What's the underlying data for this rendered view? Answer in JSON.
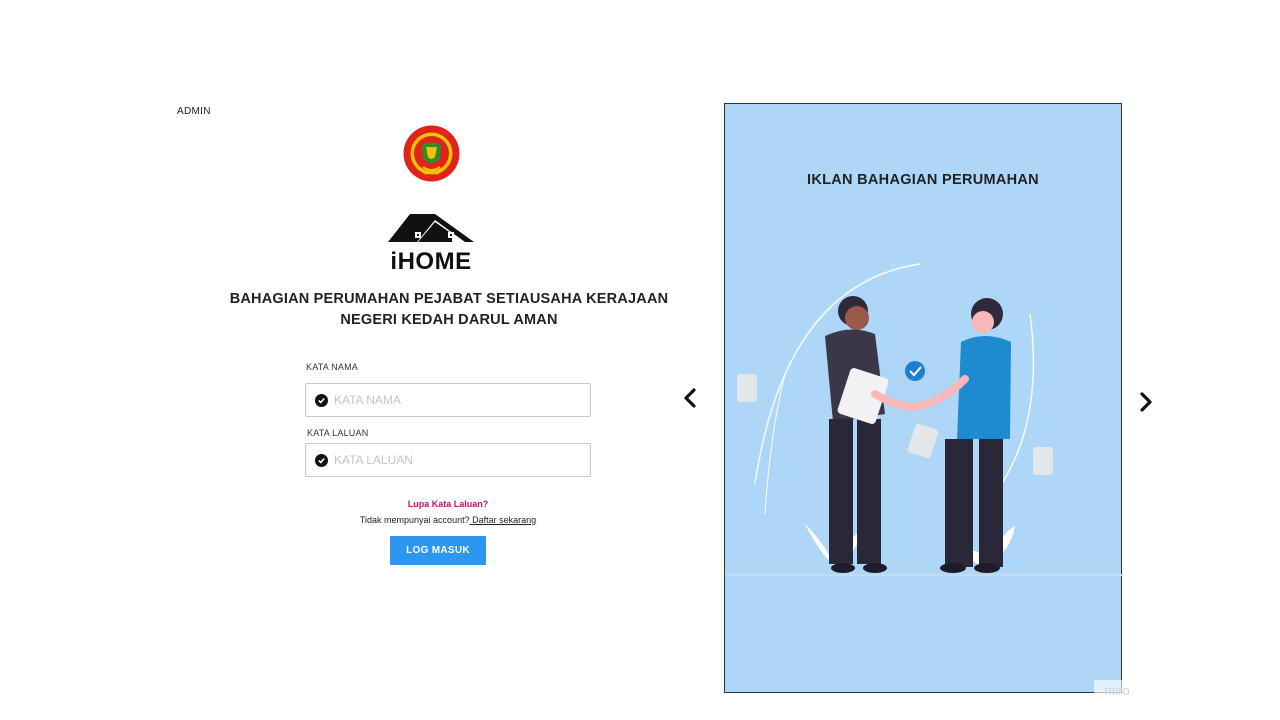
{
  "header": {
    "role_label": "ADMIN"
  },
  "logo": {
    "text": "iHOME"
  },
  "organization": {
    "line1": "BAHAGIAN PERUMAHAN PEJABAT SETIAUSAHA KERAJAAN",
    "line2": "NEGERI KEDAH DARUL AMAN"
  },
  "form": {
    "username_label": "KATA NAMA",
    "username_placeholder": "KATA NAMA",
    "password_label": "KATA LALUAN",
    "password_placeholder": "KATA LALUAN",
    "forgot_link": "Lupa Kata Laluan?",
    "no_account_text": "Tidak mempunyai account?",
    "register_link": " Daftar sekarang",
    "submit_label": "LOG MASUK"
  },
  "carousel": {
    "title": "IKLAN BAHAGIAN PERUMAHAN",
    "prev_icon": "chevron-left-icon",
    "next_icon": "chevron-right-icon"
  },
  "watermark": "miro",
  "colors": {
    "primary_button": "#2d96ef",
    "link_accent": "#c2185b",
    "panel_background": "#aed7f7"
  }
}
